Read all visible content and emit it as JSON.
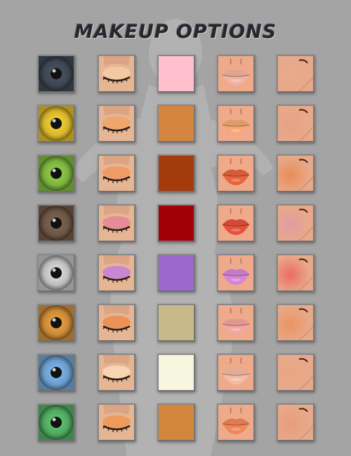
{
  "title": "MAKEUP OPTIONS",
  "rows": [
    {
      "iris": "#3d4651",
      "eyeshadow": "#f3c9a3",
      "swatch": "#ffbfcc",
      "lips": "#f1b3a0",
      "blush": "#e9a98b"
    },
    {
      "iris": "#d7b42a",
      "eyeshadow": "#f0a56d",
      "swatch": "#d4853f",
      "lips": "#f6a777",
      "blush": "#e8a186"
    },
    {
      "iris": "#7bb13c",
      "eyeshadow": "#ee9b64",
      "swatch": "#a33b0c",
      "lips": "#e8643e",
      "blush": "#e98d55"
    },
    {
      "iris": "#6d5545",
      "eyeshadow": "#e68c96",
      "swatch": "#a00006",
      "lips": "#e5503d",
      "blush": "#e19ca2"
    },
    {
      "iris": "#bcbcbc",
      "eyeshadow": "#c986d3",
      "swatch": "#9c68cf",
      "lips": "#d585d6",
      "blush": "#ec6c62"
    },
    {
      "iris": "#c98935",
      "eyeshadow": "#ec9258",
      "swatch": "#c8b88a",
      "lips": "#f3a5a0",
      "blush": "#ea9461"
    },
    {
      "iris": "#6b9ccb",
      "eyeshadow": "#f7d5b2",
      "swatch": "#f7f6df",
      "lips": "#f3bca3",
      "blush": "#eaa585"
    },
    {
      "iris": "#4ea85f",
      "eyeshadow": "#f09a5c",
      "swatch": "#d2873d",
      "lips": "#f1865a",
      "blush": "#e99d7c"
    }
  ],
  "icons": {
    "iris": "eye-iris-swatch-icon",
    "eyeshadow": "closed-eye-eyeshadow-icon",
    "swatch": "color-swatch",
    "lips": "lips-icon",
    "blush": "cheek-blush-icon"
  }
}
